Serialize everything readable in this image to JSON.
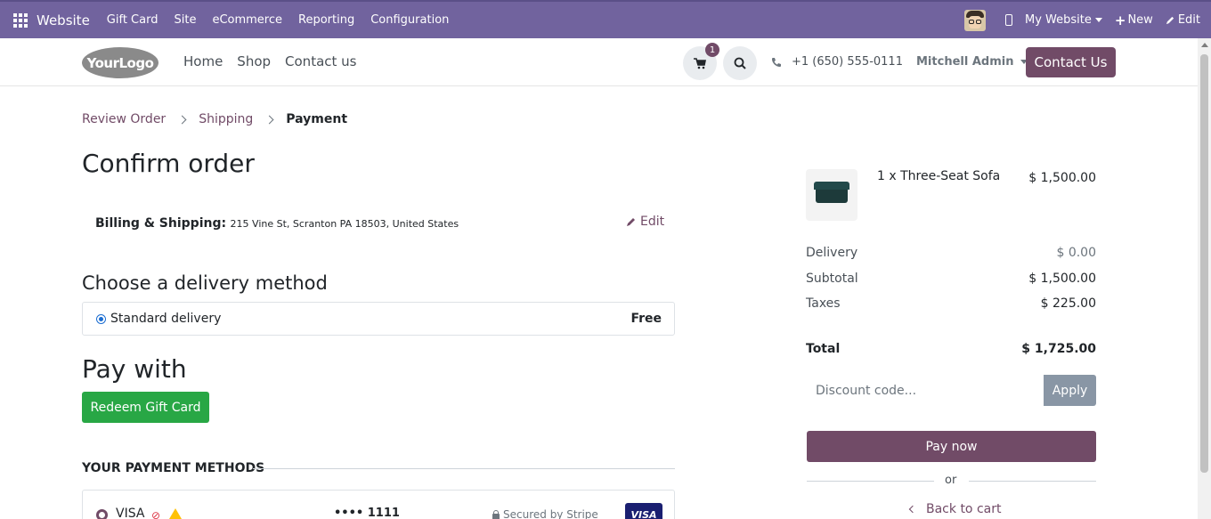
{
  "topbar": {
    "brand": "Website",
    "menu": [
      "Gift Card",
      "Site",
      "eCommerce",
      "Reporting",
      "Configuration"
    ],
    "my_website": "My Website",
    "new": "New",
    "edit": "Edit",
    "color": "#71639e"
  },
  "header": {
    "logo": "YourLogo",
    "nav": [
      "Home",
      "Shop",
      "Contact us"
    ],
    "cart_count": "1",
    "phone": "+1 (650) 555-0111",
    "user": "Mitchell Admin",
    "contact_button": "Contact Us"
  },
  "breadcrumb": {
    "items": [
      "Review Order",
      "Shipping"
    ],
    "active": "Payment"
  },
  "page": {
    "title": "Confirm order",
    "billing_label": "Billing & Shipping:",
    "billing_address": "215 Vine St, Scranton PA 18503, United States",
    "edit_label": "Edit"
  },
  "delivery": {
    "heading": "Choose a delivery method",
    "method": "Standard delivery",
    "price": "Free"
  },
  "payment": {
    "heading": "Pay with",
    "gift_button": "Redeem Gift Card",
    "methods_heading": "YOUR PAYMENT METHODS",
    "card_name": "VISA",
    "card_digits": "•••• 1111",
    "secured": "Secured by Stripe",
    "card_badge": "VISA"
  },
  "summary": {
    "product_name": "1 x Three-Seat Sofa",
    "product_price": "$ 1,500.00",
    "delivery_label": "Delivery",
    "delivery_value": "$ 0.00",
    "subtotal_label": "Subtotal",
    "subtotal_value": "$ 1,500.00",
    "taxes_label": "Taxes",
    "taxes_value": "$ 225.00",
    "total_label": "Total",
    "total_value": "$ 1,725.00",
    "discount_placeholder": "Discount code...",
    "apply_label": "Apply",
    "pay_now": "Pay now",
    "or": "or",
    "back_to_cart": "Back to cart"
  },
  "colors": {
    "primary": "#714b67",
    "success": "#28a745",
    "apply": "#8996a5"
  }
}
